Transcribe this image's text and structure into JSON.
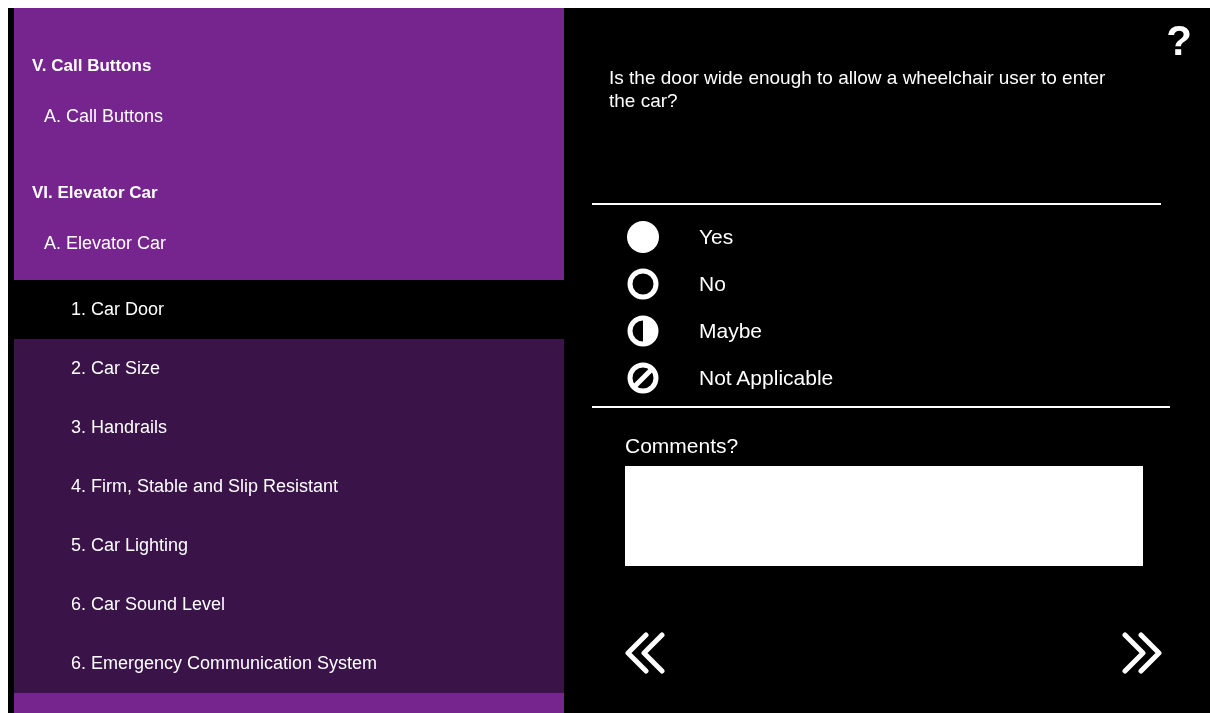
{
  "sidebar": {
    "items": [
      {
        "kind": "section",
        "label": "V. Call Buttons",
        "selected": false
      },
      {
        "kind": "subsection",
        "label": "A. Call Buttons",
        "selected": false
      },
      {
        "kind": "section",
        "label": "VI. Elevator Car",
        "selected": false
      },
      {
        "kind": "subsection",
        "label": "A. Elevator Car",
        "selected": false
      },
      {
        "kind": "item",
        "label": "1. Car Door",
        "selected": true
      },
      {
        "kind": "item",
        "label": "2. Car Size",
        "selected": false
      },
      {
        "kind": "item",
        "label": "3. Handrails",
        "selected": false
      },
      {
        "kind": "item",
        "label": "4. Firm, Stable and Slip Resistant",
        "selected": false
      },
      {
        "kind": "item",
        "label": "5. Car Lighting",
        "selected": false
      },
      {
        "kind": "item",
        "label": "6. Car Sound Level",
        "selected": false
      },
      {
        "kind": "item",
        "label": "6. Emergency Communication System",
        "selected": false
      }
    ]
  },
  "help": {
    "label": "?"
  },
  "question": "Is the door wide enough to allow a wheelchair user to enter the car?",
  "answers": [
    {
      "kind": "filled",
      "label": "Yes"
    },
    {
      "kind": "outline",
      "label": "No"
    },
    {
      "kind": "half",
      "label": "Maybe"
    },
    {
      "kind": "slashed",
      "label": "Not Applicable"
    }
  ],
  "comments": {
    "label": "Comments?"
  }
}
